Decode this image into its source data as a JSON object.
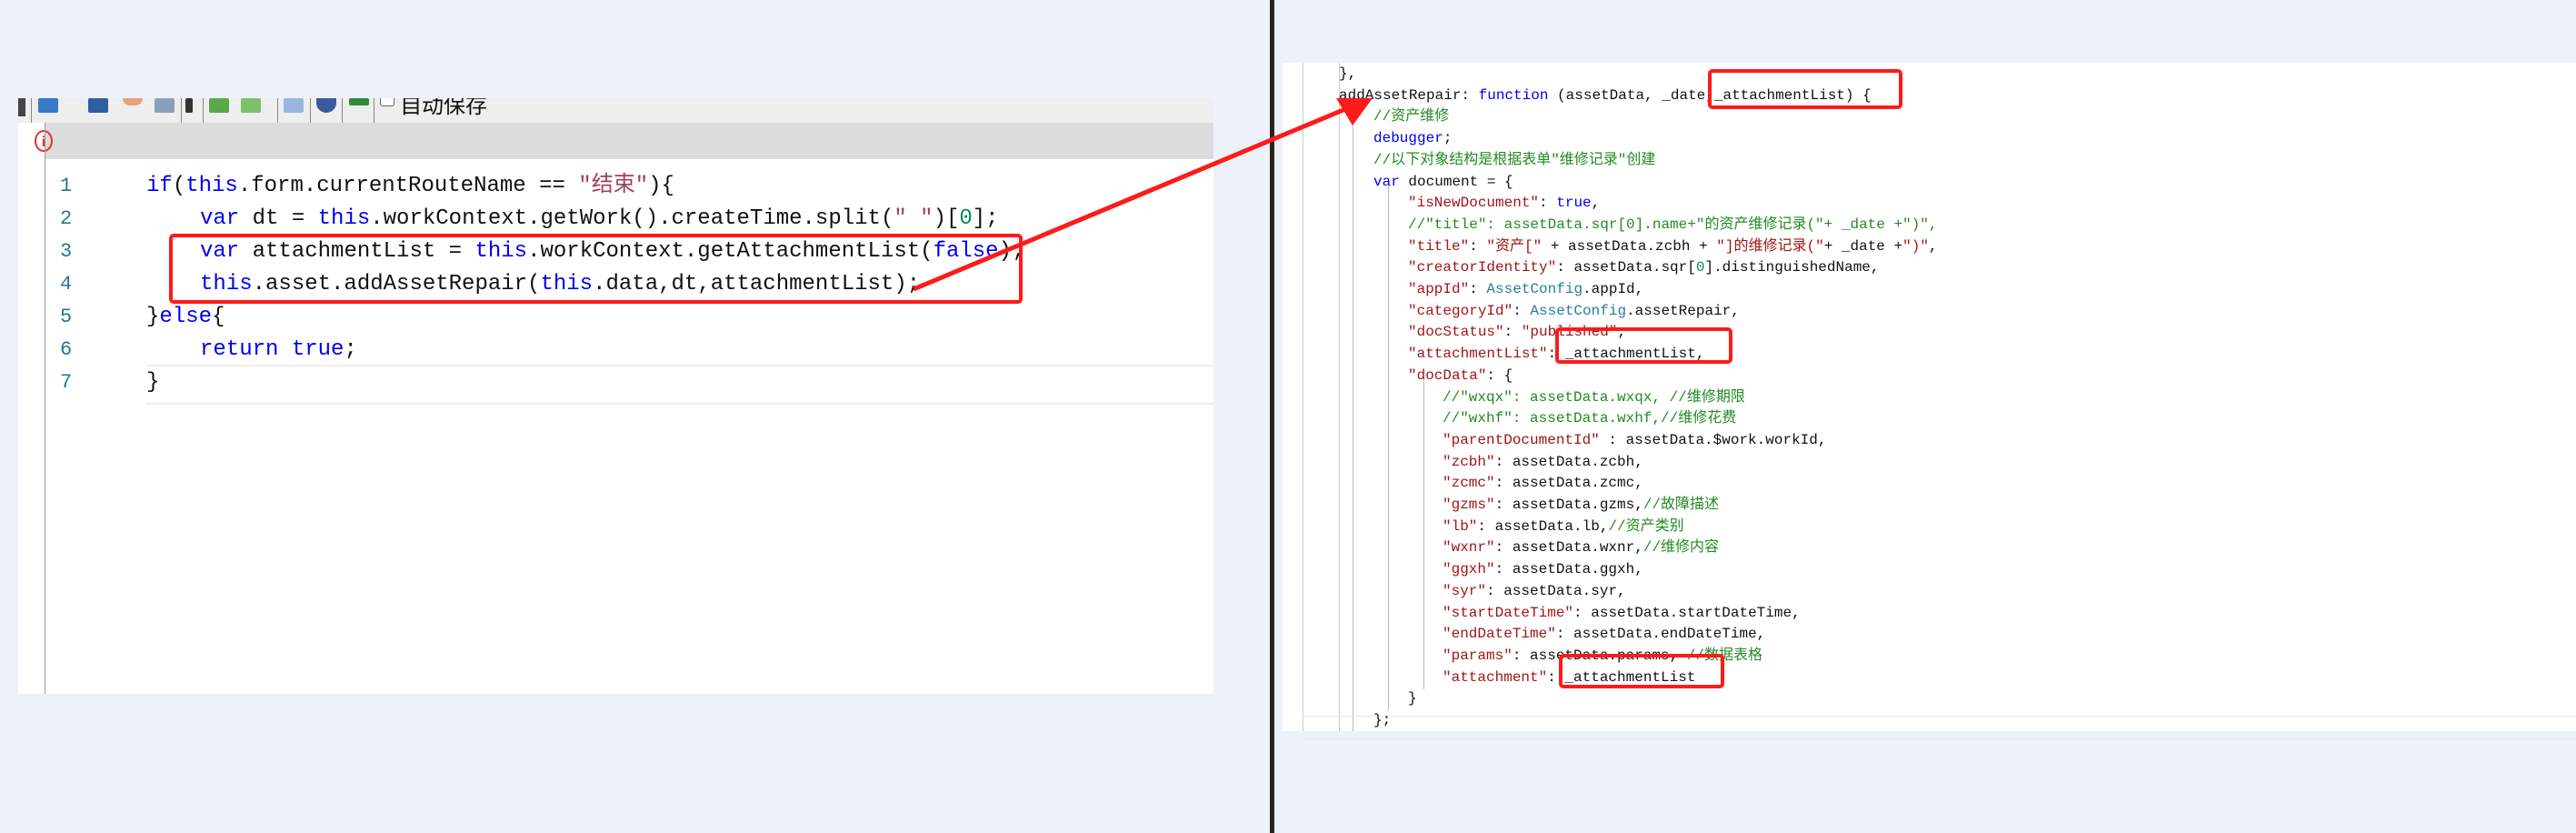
{
  "left_editor": {
    "toolbar": {
      "autosave_label": "自动保存",
      "buttons": [
        "save-icon",
        "save-as-icon",
        "undo-icon",
        "print-icon",
        "edit-icon",
        "check-in-icon",
        "check-out-icon",
        "form-icon",
        "dropdown-icon",
        "run-icon"
      ]
    },
    "error_indicator": "i",
    "lines": [
      {
        "num": "1",
        "indent": 0,
        "tokens": [
          [
            "if",
            "kw"
          ],
          [
            "(",
            ""
          ],
          [
            "this",
            "kw"
          ],
          [
            ".form.currentRouteName == ",
            ""
          ],
          [
            "\"结束\"",
            "str"
          ],
          [
            "){",
            ""
          ]
        ]
      },
      {
        "num": "2",
        "indent": 1,
        "tokens": [
          [
            "var",
            "kw"
          ],
          [
            " dt = ",
            ""
          ],
          [
            "this",
            "kw"
          ],
          [
            ".workContext.getWork().createTime.split(",
            ""
          ],
          [
            "\" \"",
            "str"
          ],
          [
            ")[",
            ""
          ],
          [
            "0",
            "num"
          ],
          [
            "];",
            ""
          ]
        ]
      },
      {
        "num": "3",
        "indent": 1,
        "tokens": [
          [
            "var",
            "kw"
          ],
          [
            " attachmentList = ",
            ""
          ],
          [
            "this",
            "kw"
          ],
          [
            ".workContext.getAttachmentList(",
            ""
          ],
          [
            "false",
            "kw"
          ],
          [
            ");",
            ""
          ]
        ]
      },
      {
        "num": "4",
        "indent": 1,
        "tokens": [
          [
            "this",
            "kw"
          ],
          [
            ".asset.addAssetRepair(",
            ""
          ],
          [
            "this",
            "kw"
          ],
          [
            ".data,dt,attachmentList);",
            ""
          ]
        ]
      },
      {
        "num": "5",
        "indent": 0,
        "tokens": [
          [
            "}",
            ""
          ],
          [
            "else",
            "kw"
          ],
          [
            "{",
            ""
          ]
        ]
      },
      {
        "num": "6",
        "indent": 1,
        "tokens": [
          [
            "return",
            "kw"
          ],
          [
            " ",
            ""
          ],
          [
            "true",
            "kw"
          ],
          [
            ";",
            ""
          ]
        ]
      },
      {
        "num": "7",
        "indent": 0,
        "tokens": [
          [
            "}",
            ""
          ]
        ]
      }
    ]
  },
  "right_editor": {
    "lines": [
      {
        "indent": 0,
        "tokens": [
          [
            "},",
            ""
          ]
        ]
      },
      {
        "indent": 0,
        "tokens": [
          [
            "addAssetRepair: ",
            ""
          ],
          [
            "function",
            "kw"
          ],
          [
            " (assetData, _date,_attachmentList) {",
            ""
          ]
        ]
      },
      {
        "indent": 1,
        "tokens": [
          [
            "//资产维修",
            "com"
          ]
        ]
      },
      {
        "indent": 1,
        "tokens": [
          [
            "debugger",
            "kw"
          ],
          [
            ";",
            ""
          ]
        ]
      },
      {
        "indent": 1,
        "tokens": [
          [
            "//以下对象结构是根据表单\"维修记录\"创建",
            "com"
          ]
        ]
      },
      {
        "indent": 1,
        "tokens": [
          [
            "var",
            "kw"
          ],
          [
            " document = {",
            ""
          ]
        ]
      },
      {
        "indent": 2,
        "tokens": [
          [
            "\"isNewDocument\"",
            "key"
          ],
          [
            ": ",
            ""
          ],
          [
            "true",
            "kw"
          ],
          [
            ",",
            ""
          ]
        ]
      },
      {
        "indent": 2,
        "tokens": [
          [
            "//\"title\": assetData.sqr[0].name+\"的资产维修记录(\"+ _date +\")\",",
            "com"
          ]
        ]
      },
      {
        "indent": 2,
        "tokens": [
          [
            "\"title\"",
            "key"
          ],
          [
            ": ",
            ""
          ],
          [
            "\"资产[\"",
            "key"
          ],
          [
            " + assetData.zcbh + ",
            ""
          ],
          [
            "\"]的维修记录(\"",
            "key"
          ],
          [
            "+ _date +",
            ""
          ],
          [
            "\")\"",
            "key"
          ],
          [
            ",",
            ""
          ]
        ]
      },
      {
        "indent": 2,
        "tokens": [
          [
            "\"creatorIdentity\"",
            "key"
          ],
          [
            ": assetData.sqr[",
            ""
          ],
          [
            "0",
            "num"
          ],
          [
            "].distinguishedName,",
            ""
          ]
        ]
      },
      {
        "indent": 2,
        "tokens": [
          [
            "\"appId\"",
            "key"
          ],
          [
            ": ",
            ""
          ],
          [
            "AssetConfig",
            "cls"
          ],
          [
            ".appId,",
            ""
          ]
        ]
      },
      {
        "indent": 2,
        "tokens": [
          [
            "\"categoryId\"",
            "key"
          ],
          [
            ": ",
            ""
          ],
          [
            "AssetConfig",
            "cls"
          ],
          [
            ".assetRepair,",
            ""
          ]
        ]
      },
      {
        "indent": 2,
        "tokens": [
          [
            "\"docStatus\"",
            "key"
          ],
          [
            ": ",
            ""
          ],
          [
            "\"published\"",
            "key"
          ],
          [
            ",",
            ""
          ]
        ]
      },
      {
        "indent": 2,
        "tokens": [
          [
            "\"attachmentList\"",
            "key"
          ],
          [
            ": _attachmentList,",
            ""
          ]
        ]
      },
      {
        "indent": 2,
        "tokens": [
          [
            "\"docData\"",
            "key"
          ],
          [
            ": {",
            ""
          ]
        ]
      },
      {
        "indent": 3,
        "tokens": [
          [
            "//\"wxqx\": assetData.wxqx, //维修期限",
            "com"
          ]
        ]
      },
      {
        "indent": 3,
        "tokens": [
          [
            "//\"wxhf\": assetData.wxhf,//维修花费",
            "com"
          ]
        ]
      },
      {
        "indent": 3,
        "tokens": [
          [
            "\"parentDocumentId\"",
            "key"
          ],
          [
            " : assetData.$work.workId,",
            ""
          ]
        ]
      },
      {
        "indent": 3,
        "tokens": [
          [
            "\"zcbh\"",
            "key"
          ],
          [
            ": assetData.zcbh,",
            ""
          ]
        ]
      },
      {
        "indent": 3,
        "tokens": [
          [
            "\"zcmc\"",
            "key"
          ],
          [
            ": assetData.zcmc,",
            ""
          ]
        ]
      },
      {
        "indent": 3,
        "tokens": [
          [
            "\"gzms\"",
            "key"
          ],
          [
            ": assetData.gzms,",
            ""
          ],
          [
            "//故障描述",
            "com"
          ]
        ]
      },
      {
        "indent": 3,
        "tokens": [
          [
            "\"lb\"",
            "key"
          ],
          [
            ": assetData.lb,",
            ""
          ],
          [
            "//资产类别",
            "com"
          ]
        ]
      },
      {
        "indent": 3,
        "tokens": [
          [
            "\"wxnr\"",
            "key"
          ],
          [
            ": assetData.wxnr,",
            ""
          ],
          [
            "//维修内容",
            "com"
          ]
        ]
      },
      {
        "indent": 3,
        "tokens": [
          [
            "\"ggxh\"",
            "key"
          ],
          [
            ": assetData.ggxh,",
            ""
          ]
        ]
      },
      {
        "indent": 3,
        "tokens": [
          [
            "\"syr\"",
            "key"
          ],
          [
            ": assetData.syr,",
            ""
          ]
        ]
      },
      {
        "indent": 3,
        "tokens": [
          [
            "\"startDateTime\"",
            "key"
          ],
          [
            ": assetData.startDateTime,",
            ""
          ]
        ]
      },
      {
        "indent": 3,
        "tokens": [
          [
            "\"endDateTime\"",
            "key"
          ],
          [
            ": assetData.endDateTime,",
            ""
          ]
        ]
      },
      {
        "indent": 3,
        "tokens": [
          [
            "\"params\"",
            "key"
          ],
          [
            ": assetData.params, ",
            ""
          ],
          [
            "//数据表格",
            "com"
          ]
        ]
      },
      {
        "indent": 3,
        "tokens": [
          [
            "\"attachment\"",
            "key"
          ],
          [
            ": _attachmentList",
            ""
          ]
        ]
      },
      {
        "indent": 2,
        "tokens": [
          [
            "}",
            ""
          ]
        ]
      },
      {
        "indent": 1,
        "tokens": [
          [
            "};",
            ""
          ]
        ]
      }
    ]
  },
  "annotation_color": "#ff1a1a"
}
